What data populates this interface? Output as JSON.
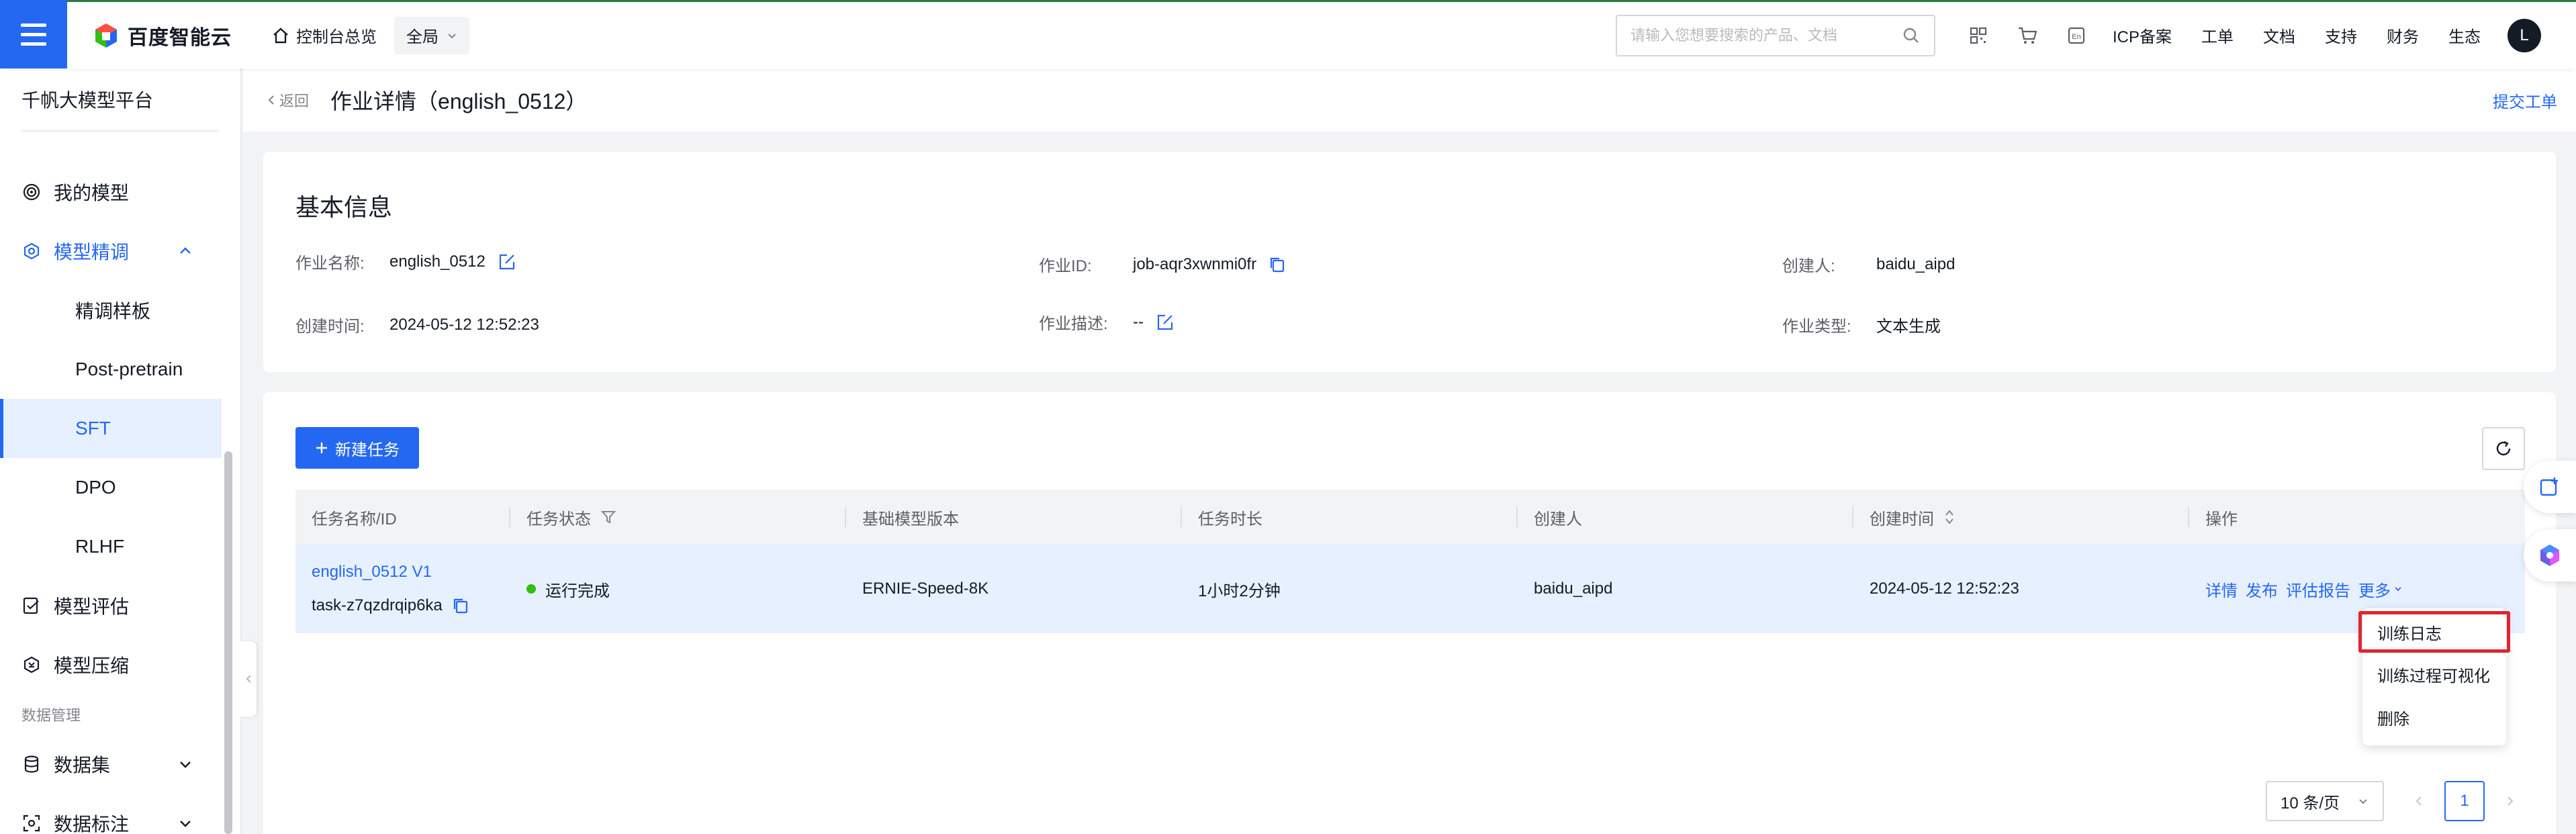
{
  "topbar": {
    "brand": "百度智能云",
    "console_home": "控制台总览",
    "scope": "全局",
    "search_placeholder": "请输入您想要搜索的产品、文档",
    "links": [
      "ICP备案",
      "工单",
      "文档",
      "支持",
      "财务",
      "生态"
    ],
    "avatar_letter": "L",
    "accent_color": "#2468f2"
  },
  "sidebar": {
    "title": "千帆大模型平台",
    "items": [
      {
        "label": "我的模型",
        "icon": "model-icon"
      },
      {
        "label": "模型精调",
        "icon": "tune-icon",
        "expanded": true
      },
      {
        "label": "模型评估",
        "icon": "evaluate-icon"
      },
      {
        "label": "模型压缩",
        "icon": "compress-icon"
      }
    ],
    "sub_items": [
      "精调样板",
      "Post-pretrain",
      "SFT",
      "DPO",
      "RLHF"
    ],
    "selected_sub": "SFT",
    "group_label": "数据管理",
    "data_items": [
      {
        "label": "数据集",
        "icon": "dataset-icon"
      },
      {
        "label": "数据标注",
        "icon": "annotate-icon"
      }
    ]
  },
  "header": {
    "back": "返回",
    "title": "作业详情（english_0512）",
    "submit_ticket": "提交工单"
  },
  "basic_info": {
    "title": "基本信息",
    "job_name_label": "作业名称:",
    "job_name": "english_0512",
    "job_id_label": "作业ID:",
    "job_id": "job-aqr3xwnmi0fr",
    "creator_label": "创建人:",
    "creator": "baidu_aipd",
    "created_time_label": "创建时间:",
    "created_time": "2024-05-12 12:52:23",
    "desc_label": "作业描述:",
    "desc": "--",
    "type_label": "作业类型:",
    "type": "文本生成"
  },
  "tasks": {
    "new_task": "新建任务",
    "columns": [
      "任务名称/ID",
      "任务状态",
      "基础模型版本",
      "任务时长",
      "创建人",
      "创建时间",
      "操作"
    ],
    "rows": [
      {
        "name": "english_0512 V1",
        "id": "task-z7qzdrqip6ka",
        "status": "运行完成",
        "status_color": "#30bf13",
        "base_model": "ERNIE-Speed-8K",
        "duration": "1小时2分钟",
        "creator": "baidu_aipd",
        "created": "2024-05-12 12:52:23",
        "ops": [
          "详情",
          "发布",
          "评估报告",
          "更多"
        ]
      }
    ]
  },
  "more_menu": {
    "items": [
      "训练日志",
      "训练过程可视化",
      "删除"
    ],
    "highlighted": "训练日志",
    "highlight_color": "#e0252e"
  },
  "pagination": {
    "page_size": "10 条/页",
    "current_page": "1"
  }
}
